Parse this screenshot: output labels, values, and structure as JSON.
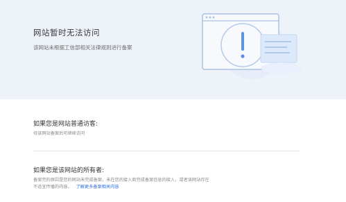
{
  "hero": {
    "title": "网站暂时无法访问",
    "description": "该网站未根据工信部相关法律规则进行备案"
  },
  "illustration": {
    "icon": "warning-exclamation-illustration",
    "colors": {
      "frame_stroke": "#a9c2e6",
      "accent": "#5b93e0",
      "panel": "#dce9fb",
      "circle": "#e6edf8"
    }
  },
  "visitor": {
    "title": "如果您是网站普通访客:",
    "text": "待该网站备案后可继续访问"
  },
  "owner": {
    "title": "如果您是该网站的所有者:",
    "line1": "备案完的原因是您的网站未完成备案，未在您的接入商完成备案信息的接入，或者该网站存在",
    "line2": "不适宜传播的内容。",
    "link_label": "了解更多备案相关内容"
  }
}
